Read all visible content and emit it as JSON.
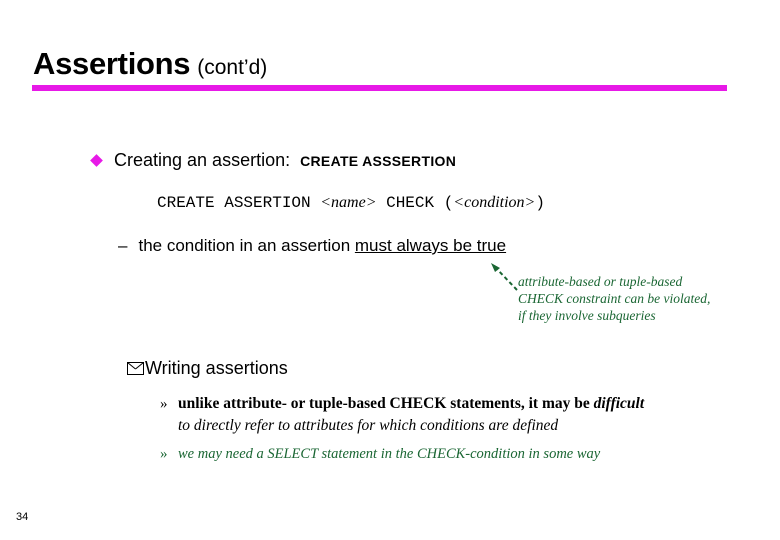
{
  "slide": {
    "page_number": "34",
    "colors": {
      "accent_magenta": "#e719e7",
      "annotation_green": "#1a6633",
      "text_black": "#000000",
      "background": "#ffffff"
    },
    "title": {
      "main": "Assertions",
      "suffix": "(cont’d)"
    },
    "bullet_level1": {
      "marker": "diamond-bullet",
      "text": "Creating an assertion:",
      "keyword": "CREATE ASSSERTION"
    },
    "syntax_line": {
      "part1": "CREATE ASSERTION ",
      "placeholder1": "<name>",
      "part2": " CHECK  (",
      "placeholder2": "<condition>",
      "part3": ")"
    },
    "dash_bullet": {
      "marker": "–",
      "text_plain": "the condition in an assertion ",
      "text_underlined": "must always be true"
    },
    "annotation": {
      "arrow": "dashed-arrow-up-left",
      "lines": [
        "attribute-based or tuple-based",
        "CHECK constraint can be violated,",
        "if they involve subqueries"
      ]
    },
    "bullet_level2": {
      "marker": "envelope-bullet",
      "text": "Writing assertions"
    },
    "sub_bullets": [
      {
        "marker": "»",
        "line1_bold": "unlike attribute- or tuple-based CHECK statements, it may be ",
        "line1_italic": "difficult",
        "line2_italic": "to directly refer to attributes for which conditions are defined",
        "color": "black"
      },
      {
        "marker": "»",
        "text": "we may need a SELECT statement in the CHECK-condition in some way",
        "color": "green"
      }
    ]
  }
}
